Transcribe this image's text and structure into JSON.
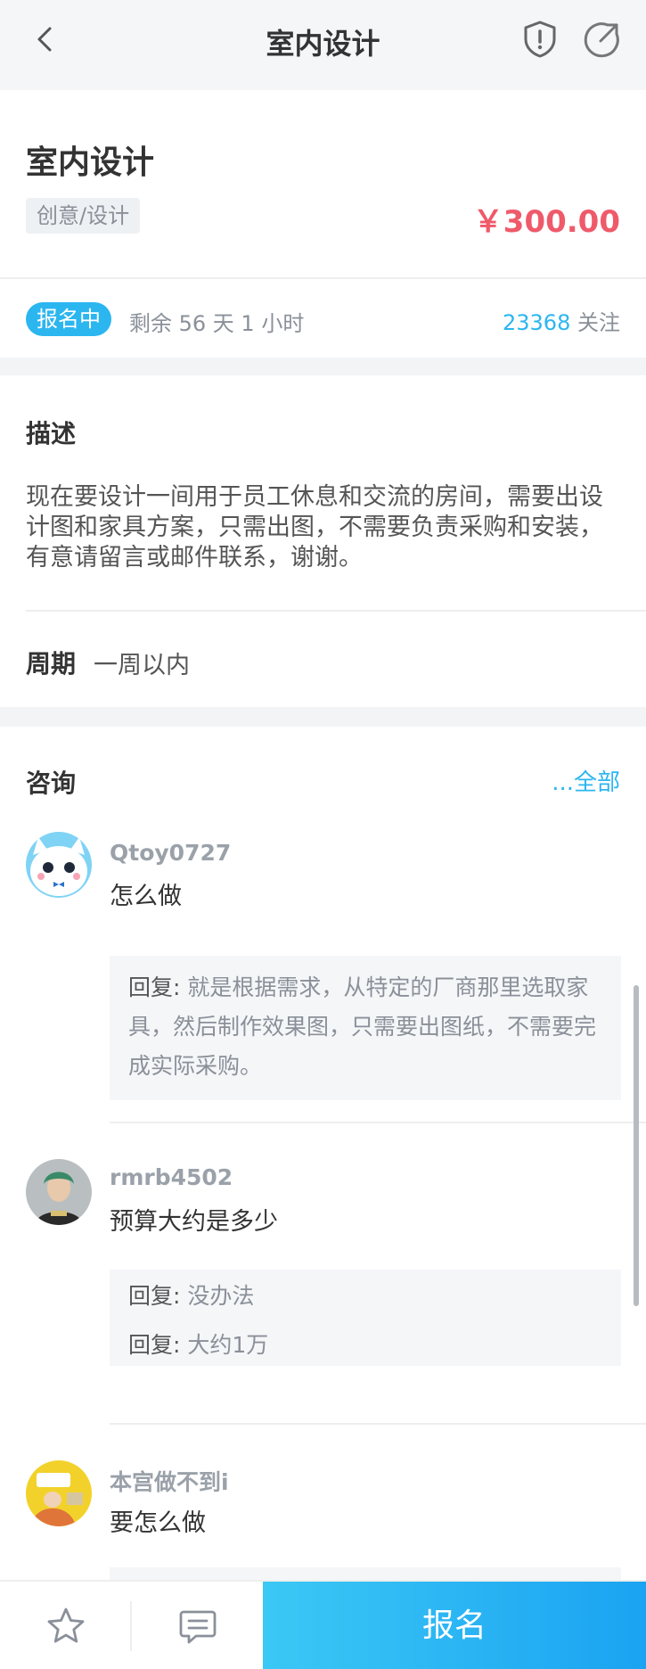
{
  "header": {
    "title": "室内设计"
  },
  "project": {
    "title": "室内设计",
    "tag": "创意/设计",
    "price": "￥300.00",
    "status": "报名中",
    "remaining": "剩余 56 天 1 小时",
    "follow_count": "23368",
    "follow_label": " 关注"
  },
  "description": {
    "heading": "描述",
    "text": "现在要设计一间用于员工休息和交流的房间，需要出设计图和家具方案，只需出图，不需要负责采购和安装，有意请留言或邮件联系，谢谢。",
    "period_label": "周期",
    "period_value": "一周以内"
  },
  "consult": {
    "heading": "咨询",
    "all_link": "...全部",
    "reply_prefix": "回复:",
    "items": [
      {
        "user": "Qtoy0727",
        "question": "怎么做",
        "replies": [
          "就是根据需求，从特定的厂商那里选取家具，然后制作效果图，只需要出图纸，不需要完成实际采购。"
        ]
      },
      {
        "user": "rmrb4502",
        "question": "预算大约是多少",
        "replies": [
          "没办法",
          "大约1万"
        ]
      },
      {
        "user": "本宫做不到i",
        "question": "要怎么做",
        "replies": []
      }
    ]
  },
  "bottom": {
    "signup_label": "报名"
  },
  "colors": {
    "accent": "#2cb6f0",
    "price": "#ef5a6a"
  }
}
